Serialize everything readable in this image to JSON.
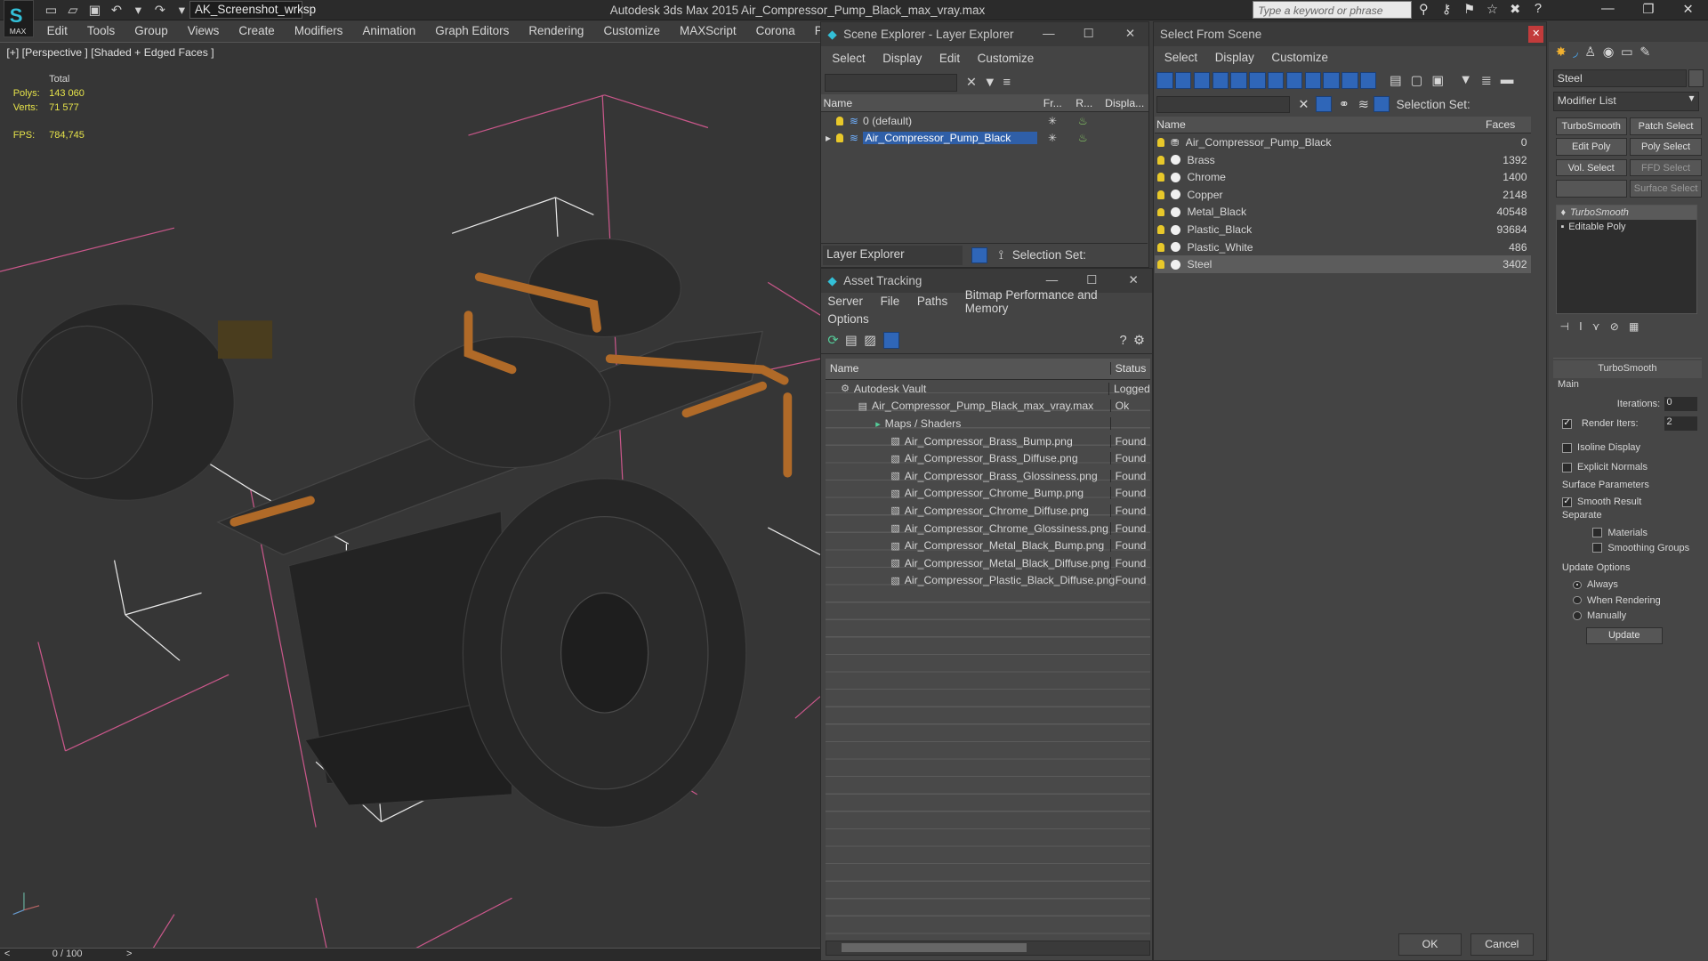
{
  "app": {
    "logo_text": "MAX",
    "workspace": "AK_Screenshot_wrksp",
    "title": "Autodesk 3ds Max  2015    Air_Compressor_Pump_Black_max_vray.max",
    "search_placeholder": "Type a keyword or phrase"
  },
  "menu": [
    "Edit",
    "Tools",
    "Group",
    "Views",
    "Create",
    "Modifiers",
    "Animation",
    "Graph Editors",
    "Rendering",
    "Customize",
    "MAXScript",
    "Corona",
    "Project Man"
  ],
  "viewport": {
    "label": "[+] [Perspective ] [Shaded + Edged Faces ]",
    "stats": {
      "total_label": "Total",
      "polys_label": "Polys:",
      "polys": "143 060",
      "verts_label": "Verts:",
      "verts": "71 577",
      "fps_label": "FPS:",
      "fps": "784,745"
    }
  },
  "timeline": {
    "frame": "0 / 100"
  },
  "scene_explorer": {
    "title": "Scene Explorer - Layer Explorer",
    "menu": [
      "Select",
      "Display",
      "Edit",
      "Customize"
    ],
    "cols": [
      "Name",
      "Fr...",
      "R...",
      "Displa..."
    ],
    "rows": [
      "0 (default)",
      "Air_Compressor_Pump_Black"
    ],
    "footer_dropdown": "Layer Explorer",
    "selection_set": "Selection Set:"
  },
  "asset_tracking": {
    "title": "Asset Tracking",
    "menu": [
      "Server",
      "File",
      "Paths",
      "Bitmap Performance and Memory"
    ],
    "menu2": "Options",
    "cols": [
      "Name",
      "Status"
    ],
    "rows": [
      {
        "name": "Autodesk Vault",
        "status": "Logged"
      },
      {
        "name": "Air_Compressor_Pump_Black_max_vray.max",
        "status": "Ok"
      },
      {
        "name": "Maps / Shaders",
        "status": ""
      },
      {
        "name": "Air_Compressor_Brass_Bump.png",
        "status": "Found"
      },
      {
        "name": "Air_Compressor_Brass_Diffuse.png",
        "status": "Found"
      },
      {
        "name": "Air_Compressor_Brass_Glossiness.png",
        "status": "Found"
      },
      {
        "name": "Air_Compressor_Chrome_Bump.png",
        "status": "Found"
      },
      {
        "name": "Air_Compressor_Chrome_Diffuse.png",
        "status": "Found"
      },
      {
        "name": "Air_Compressor_Chrome_Glossiness.png",
        "status": "Found"
      },
      {
        "name": "Air_Compressor_Metal_Black_Bump.png",
        "status": "Found"
      },
      {
        "name": "Air_Compressor_Metal_Black_Diffuse.png",
        "status": "Found"
      },
      {
        "name": "Air_Compressor_Plastic_Black_Diffuse.png",
        "status": "Found"
      }
    ]
  },
  "select_from_scene": {
    "title": "Select From Scene",
    "menu": [
      "Select",
      "Display",
      "Customize"
    ],
    "selection_set": "Selection Set:",
    "cols": [
      "Name",
      "Faces"
    ],
    "rows": [
      {
        "name": "Air_Compressor_Pump_Black",
        "faces": "0"
      },
      {
        "name": "Brass",
        "faces": "1392"
      },
      {
        "name": "Chrome",
        "faces": "1400"
      },
      {
        "name": "Copper",
        "faces": "2148"
      },
      {
        "name": "Metal_Black",
        "faces": "40548"
      },
      {
        "name": "Plastic_Black",
        "faces": "93684"
      },
      {
        "name": "Plastic_White",
        "faces": "486"
      },
      {
        "name": "Steel",
        "faces": "3402"
      }
    ],
    "ok": "OK",
    "cancel": "Cancel"
  },
  "modify_panel": {
    "object_name": "Steel",
    "modifier_list": "Modifier List",
    "buttons": [
      "TurboSmooth",
      "Patch Select",
      "Edit Poly",
      "Poly Select",
      "Vol. Select",
      "FFD Select",
      "",
      "Surface Select"
    ],
    "stack": [
      "TurboSmooth",
      "Editable Poly"
    ],
    "rollout_title": "TurboSmooth",
    "main_label": "Main",
    "iterations_label": "Iterations:",
    "iterations": "0",
    "render_iters_label": "Render Iters:",
    "render_iters": "2",
    "isoline": "Isoline Display",
    "explicit_normals": "Explicit Normals",
    "surface_params": "Surface Parameters",
    "smooth_result": "Smooth Result",
    "separate": "Separate",
    "materials": "Materials",
    "smoothing_groups": "Smoothing Groups",
    "update_options": "Update Options",
    "always": "Always",
    "when_rendering": "When Rendering",
    "manually": "Manually",
    "update": "Update"
  }
}
